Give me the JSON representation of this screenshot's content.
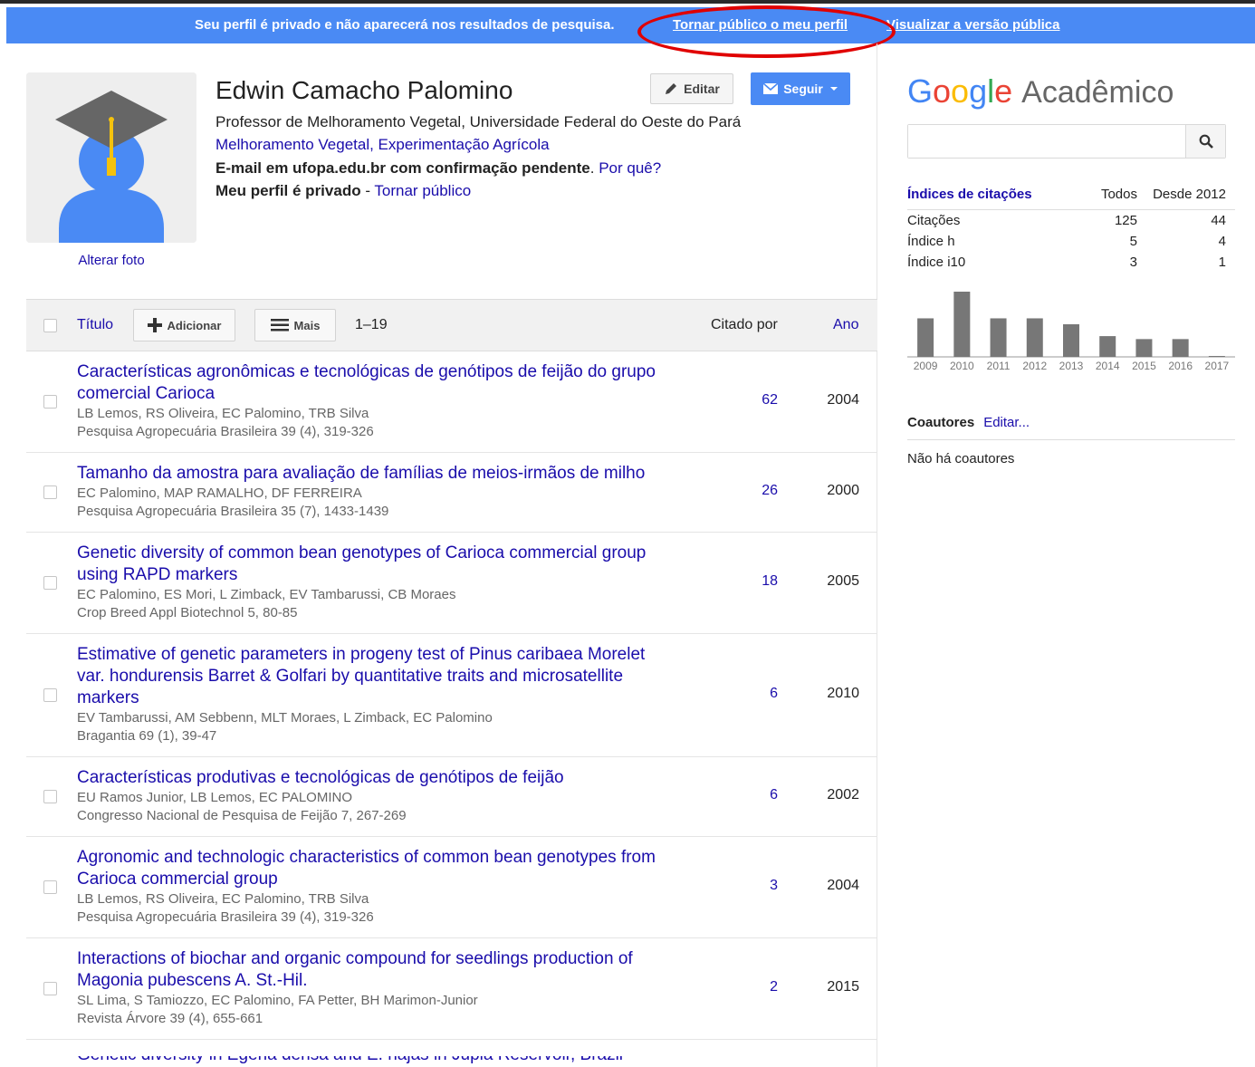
{
  "banner": {
    "message": "Seu perfil é privado e não aparecerá nos resultados de pesquisa.",
    "make_public_link": "Tornar público o meu perfil",
    "view_public_link": "Visualizar a versão pública"
  },
  "profile": {
    "name": "Edwin Camacho Palomino",
    "change_photo": "Alterar foto",
    "edit_label": "Editar",
    "follow_label": "Seguir",
    "affiliation": "Professor de Melhoramento Vegetal, Universidade Federal do Oeste do Pará",
    "topics": "Melhoramento Vegetal, Experimentação Agrícola",
    "email_status": "E-mail em ufopa.edu.br com confirmação pendente",
    "email_why": "Por quê?",
    "private_status": "Meu perfil é privado",
    "private_separator": " - ",
    "make_public": "Tornar público"
  },
  "table": {
    "title_header": "Título",
    "add_label": "Adicionar",
    "more_label": "Mais",
    "range": "1–19",
    "cited_header": "Citado por",
    "year_header": "Ano"
  },
  "articles": [
    {
      "title": "Características agronômicas e tecnológicas de genótipos de feijão do grupo comercial Carioca",
      "authors": "LB Lemos, RS Oliveira, EC Palomino, TRB Silva",
      "venue": "Pesquisa Agropecuária Brasileira 39 (4), 319-326",
      "cited": "62",
      "year": "2004"
    },
    {
      "title": "Tamanho da amostra para avaliação de famílias de meios-irmãos de milho",
      "authors": "EC Palomino, MAP RAMALHO, DF FERREIRA",
      "venue": "Pesquisa Agropecuária Brasileira 35 (7), 1433-1439",
      "cited": "26",
      "year": "2000"
    },
    {
      "title": "Genetic diversity of common bean genotypes of Carioca commercial group using RAPD markers",
      "authors": "EC Palomino, ES Mori, L Zimback, EV Tambarussi, CB Moraes",
      "venue": "Crop Breed Appl Biotechnol 5, 80-85",
      "cited": "18",
      "year": "2005"
    },
    {
      "title": "Estimative of genetic parameters in progeny test of Pinus caribaea Morelet var. hondurensis Barret & Golfari by quantitative traits and microsatellite markers",
      "authors": "EV Tambarussi, AM Sebbenn, MLT Moraes, L Zimback, EC Palomino",
      "venue": "Bragantia 69 (1), 39-47",
      "cited": "6",
      "year": "2010"
    },
    {
      "title": "Características produtivas e tecnológicas de genótipos de feijão",
      "authors": "EU Ramos Junior, LB Lemos, EC PALOMINO",
      "venue": "Congresso Nacional de Pesquisa de Feijão 7, 267-269",
      "cited": "6",
      "year": "2002"
    },
    {
      "title": "Agronomic and technologic characteristics of common bean genotypes from Carioca commercial group",
      "authors": "LB Lemos, RS Oliveira, EC Palomino, TRB Silva",
      "venue": "Pesquisa Agropecuária Brasileira 39 (4), 319-326",
      "cited": "3",
      "year": "2004"
    },
    {
      "title": "Interactions of biochar and organic compound for seedlings production of Magonia pubescens A. St.-Hil.",
      "authors": "SL Lima, S Tamiozzo, EC Palomino, FA Petter, BH Marimon-Junior",
      "venue": "Revista Árvore 39 (4), 655-661",
      "cited": "2",
      "year": "2015"
    }
  ],
  "cutoff_title": "Genetic diversity in Egeria densa and E. najas in Jupiá Reservoir, Brazil",
  "sidebar": {
    "logo_google": "Google",
    "logo_suffix": "Acadêmico",
    "search_value": "",
    "citations": {
      "header": "Índices de citações",
      "col_all": "Todos",
      "col_since": "Desde 2012",
      "rows": [
        {
          "label": "Citações",
          "all": "125",
          "since": "44"
        },
        {
          "label": "Índice h",
          "all": "5",
          "since": "4"
        },
        {
          "label": "Índice i10",
          "all": "3",
          "since": "1"
        }
      ]
    },
    "coauthors_header": "Coautores",
    "coauthors_edit": "Editar...",
    "no_coauthors": "Não há coautores"
  },
  "colors": {
    "banner": "#4a8af4",
    "link": "#1a0dab",
    "bar": "#777777",
    "highlight_circle": "#e00000"
  },
  "chart_data": {
    "type": "bar",
    "categories": [
      "2009",
      "2010",
      "2011",
      "2012",
      "2013",
      "2014",
      "2015",
      "2016",
      "2017"
    ],
    "values": [
      13,
      22,
      13,
      13,
      11,
      7,
      6,
      6,
      0.3
    ],
    "ylim": [
      0,
      22
    ],
    "grid": false,
    "axis_numbers_visible": false
  }
}
